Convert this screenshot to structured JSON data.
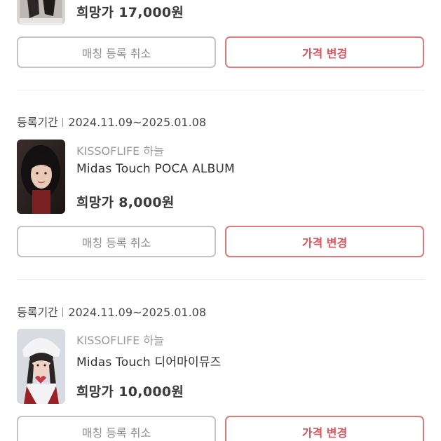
{
  "listings": [
    {
      "price": "희망가 17,000원",
      "buttons": {
        "cancel": "매칭 등록 취소",
        "change_price": "가격 변경"
      }
    },
    {
      "period_label": "등록기간",
      "period_value": "2024.11.09~2025.01.08",
      "artist": "KISSOFLIFE 하늘",
      "title": "Midas Touch POCA ALBUM",
      "price": "희망가 8,000원",
      "buttons": {
        "cancel": "매칭 등록 취소",
        "change_price": "가격 변경"
      }
    },
    {
      "period_label": "등록기간",
      "period_value": "2024.11.09~2025.01.08",
      "artist": "KISSOFLIFE 하늘",
      "title": "Midas Touch 디어마이뮤즈",
      "price": "희망가 10,000원",
      "buttons": {
        "cancel": "매칭 등록 취소",
        "change_price": "가격 변경"
      }
    }
  ],
  "colors": {
    "accent": "#d9535a",
    "accent_border": "#e07a7a",
    "neutral_border": "#c4c4c4"
  }
}
